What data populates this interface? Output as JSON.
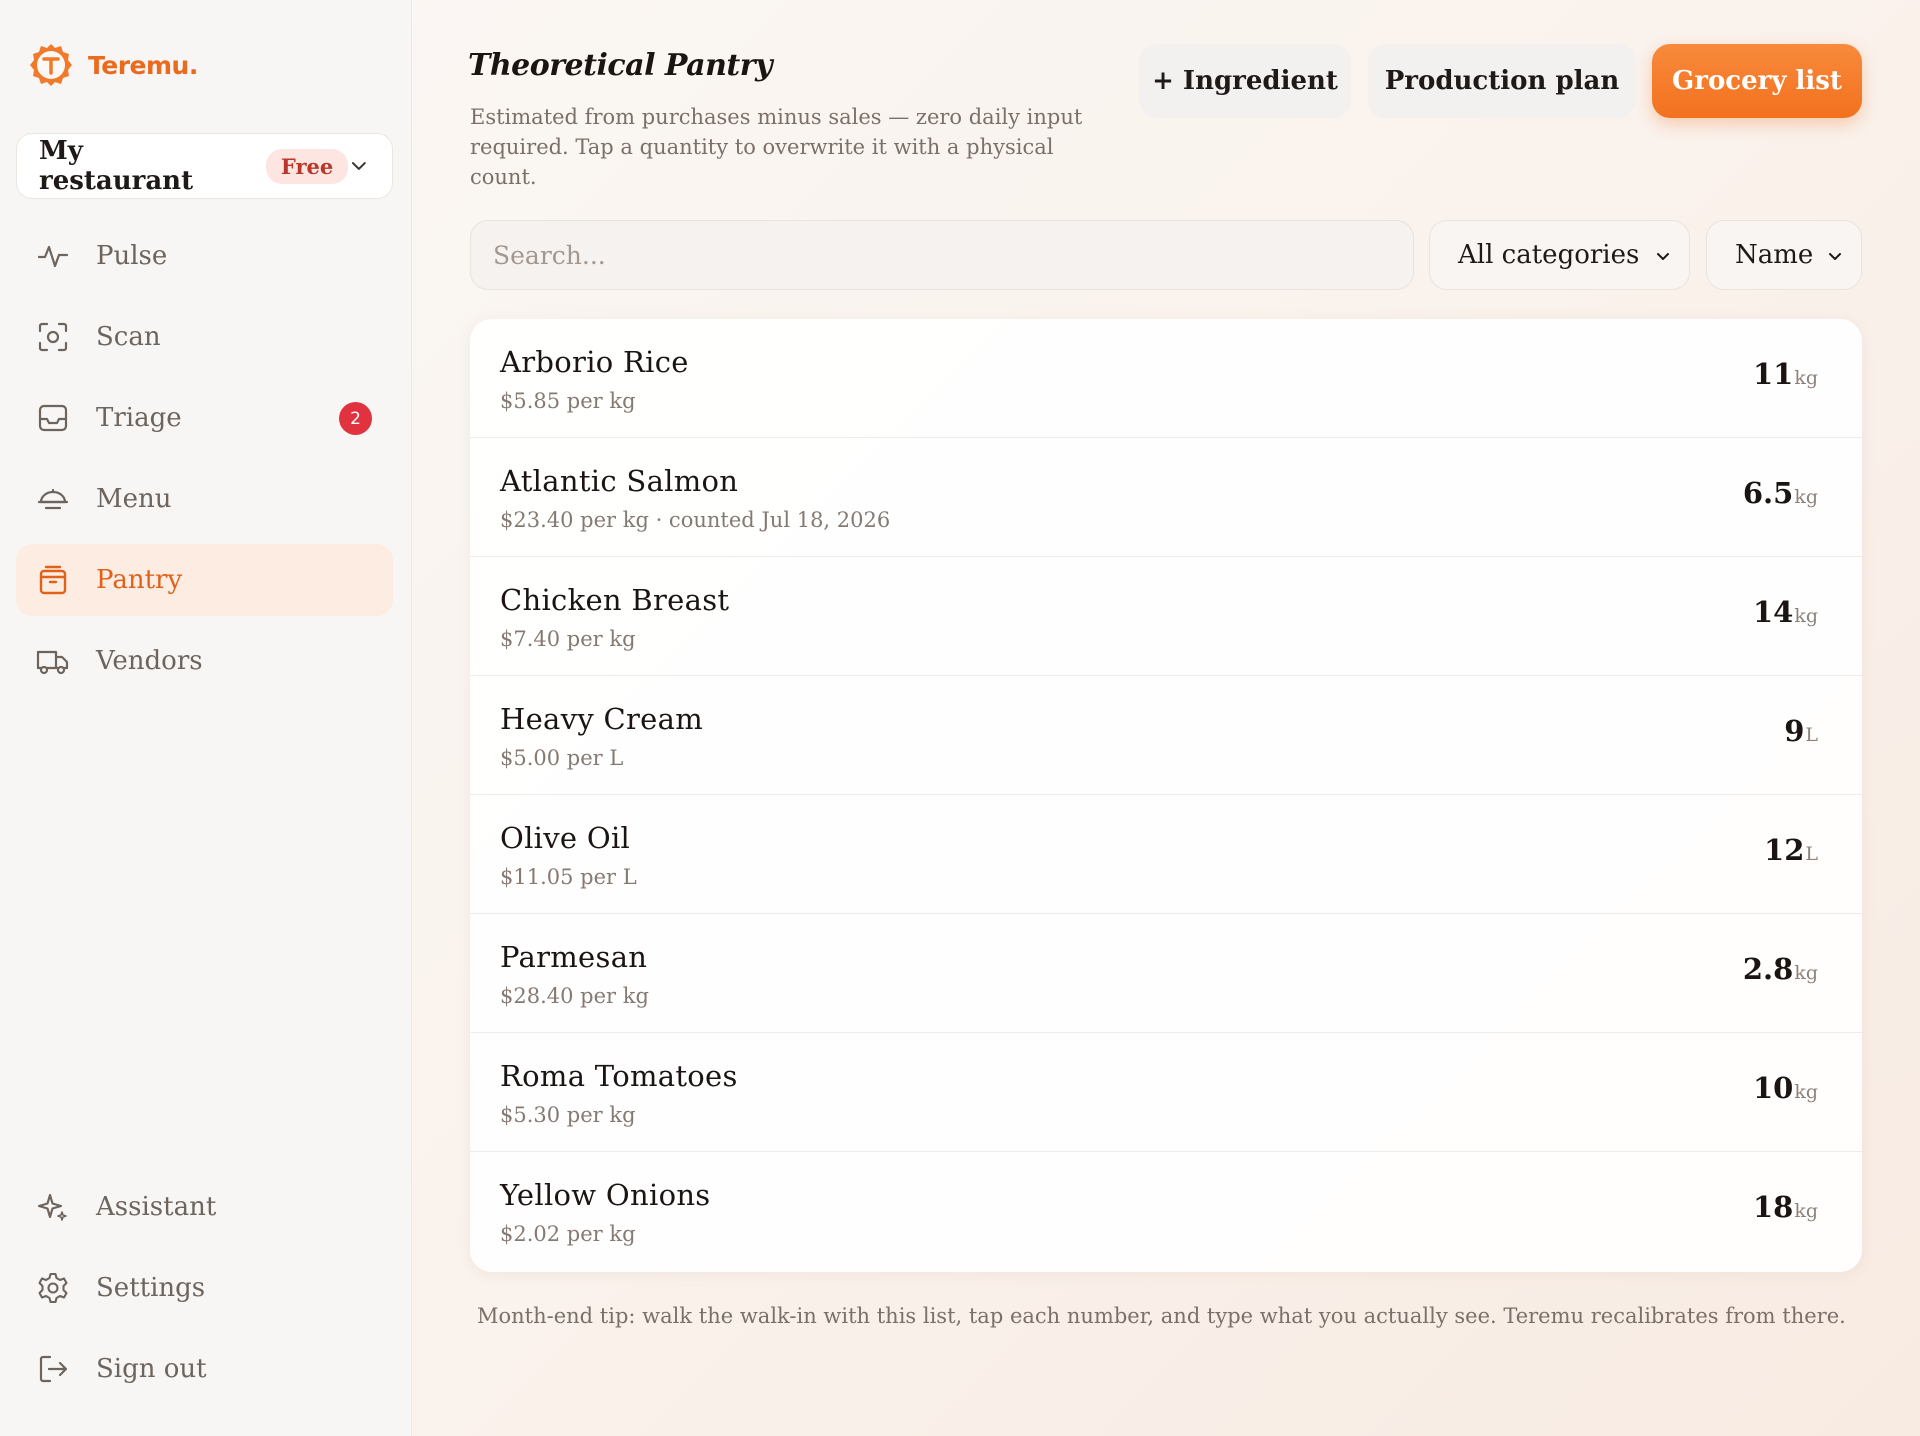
{
  "app": {
    "name": "Teremu."
  },
  "restaurant": {
    "name": "My restaurant",
    "plan": "Free"
  },
  "nav": [
    {
      "label": "Pulse",
      "icon": "pulse-icon"
    },
    {
      "label": "Scan",
      "icon": "scan-icon"
    },
    {
      "label": "Triage",
      "icon": "inbox-icon",
      "badge": "2"
    },
    {
      "label": "Menu",
      "icon": "cloche-icon"
    },
    {
      "label": "Pantry",
      "icon": "pantry-icon",
      "active": true
    },
    {
      "label": "Vendors",
      "icon": "truck-icon"
    }
  ],
  "nav_bottom": [
    {
      "label": "Assistant",
      "icon": "sparkle-icon"
    },
    {
      "label": "Settings",
      "icon": "gear-icon"
    },
    {
      "label": "Sign out",
      "icon": "sign-out-icon"
    }
  ],
  "page": {
    "title": "Theoretical Pantry",
    "subtitle": "Estimated from purchases minus sales — zero daily input required. Tap a quantity to overwrite it with a physical count."
  },
  "actions": {
    "ingredient": "+ Ingredient",
    "production": "Production plan",
    "grocery": "Grocery list"
  },
  "filters": {
    "search_placeholder": "Search...",
    "category": "All categories",
    "sort": "Name"
  },
  "items": [
    {
      "name": "Arborio Rice",
      "meta": "$5.85 per kg",
      "qty": "11",
      "unit": "kg"
    },
    {
      "name": "Atlantic Salmon",
      "meta": "$23.40 per kg · counted Jul 18, 2026",
      "qty": "6.5",
      "unit": "kg"
    },
    {
      "name": "Chicken Breast",
      "meta": "$7.40 per kg",
      "qty": "14",
      "unit": "kg"
    },
    {
      "name": "Heavy Cream",
      "meta": "$5.00 per L",
      "qty": "9",
      "unit": "L"
    },
    {
      "name": "Olive Oil",
      "meta": "$11.05 per L",
      "qty": "12",
      "unit": "L"
    },
    {
      "name": "Parmesan",
      "meta": "$28.40 per kg",
      "qty": "2.8",
      "unit": "kg"
    },
    {
      "name": "Roma Tomatoes",
      "meta": "$5.30 per kg",
      "qty": "10",
      "unit": "kg"
    },
    {
      "name": "Yellow Onions",
      "meta": "$2.02 per kg",
      "qty": "18",
      "unit": "kg"
    }
  ],
  "tip": "Month-end tip: walk the walk-in with this list, tap each number, and type what you actually see. Teremu recalibrates from there.",
  "colors": {
    "accent": "#f2711e",
    "active_bg": "#fcece1",
    "badge": "#e0333f"
  }
}
